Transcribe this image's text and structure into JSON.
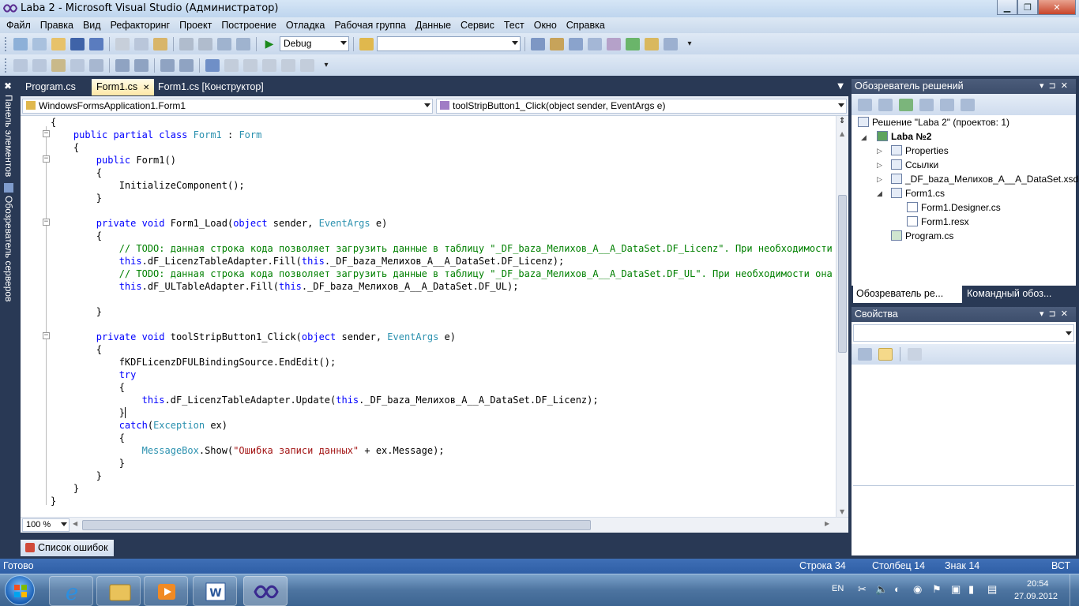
{
  "window": {
    "title": "Laba 2 - Microsoft Visual Studio (Администратор)"
  },
  "menu": [
    "Файл",
    "Правка",
    "Вид",
    "Рефакторинг",
    "Проект",
    "Построение",
    "Отладка",
    "Рабочая группа",
    "Данные",
    "Сервис",
    "Тест",
    "Окно",
    "Справка"
  ],
  "toolbar": {
    "config": "Debug",
    "find": ""
  },
  "side_panels": {
    "toolbox": "Панель элементов",
    "server_explorer": "Обозреватель серверов"
  },
  "tabs": [
    {
      "label": "Program.cs"
    },
    {
      "label": "Form1.cs",
      "active": true,
      "close": "✕"
    },
    {
      "label": "Form1.cs [Конструктор]"
    }
  ],
  "nav": {
    "class": "WindowsFormsApplication1.Form1",
    "member": "toolStripButton1_Click(object sender, EventArgs e)"
  },
  "code": [
    "{",
    "    public partial class Form1 : Form",
    "    {",
    "        public Form1()",
    "        {",
    "            InitializeComponent();",
    "        }",
    "",
    "        private void Form1_Load(object sender, EventArgs e)",
    "        {",
    "            // TODO: данная строка кода позволяет загрузить данные в таблицу \"_DF_baza_Мелихов_А__А_DataSet.DF_Licenz\". При необходимости она",
    "            this.dF_LicenzTableAdapter.Fill(this._DF_baza_Мелихов_А__А_DataSet.DF_Licenz);",
    "            // TODO: данная строка кода позволяет загрузить данные в таблицу \"_DF_baza_Мелихов_А__А_DataSet.DF_UL\". При необходимости она може",
    "            this.dF_ULTableAdapter.Fill(this._DF_baza_Мелихов_А__А_DataSet.DF_UL);",
    "",
    "        }",
    "",
    "        private void toolStripButton1_Click(object sender, EventArgs e)",
    "        {",
    "            fKDFLicenzDFULBindingSource.EndEdit();",
    "            try",
    "            {",
    "                this.dF_LicenzTableAdapter.Update(this._DF_baza_Мелихов_А__А_DataSet.DF_Licenz);",
    "            }",
    "            catch(Exception ex)",
    "            {",
    "                MessageBox.Show(\"Ошибка записи данных\" + ex.Message);",
    "            }",
    "        }",
    "    }",
    "}"
  ],
  "zoom": "100 %",
  "error_list": "Список ошибок",
  "solution_explorer": {
    "title": "Обозреватель решений",
    "solution": "Решение \"Laba 2\"  (проектов: 1)",
    "project": "Laba №2",
    "items": [
      "Properties",
      "Ссылки",
      "_DF_baza_Мелихов_А__А_DataSet.xsd",
      "Form1.cs",
      "Form1.Designer.cs",
      "Form1.resx",
      "Program.cs"
    ],
    "tab1": "Обозреватель ре...",
    "tab2": "Командный обоз..."
  },
  "properties": {
    "title": "Свойства"
  },
  "status": {
    "ready": "Готово",
    "line": "Строка 34",
    "col": "Столбец 14",
    "char": "Знак 14",
    "mode": "ВСТ"
  },
  "tray": {
    "lang": "EN",
    "time": "20:54",
    "date": "27.09.2012"
  },
  "colors": {
    "accent": "#293955",
    "keyword": "#0000ff",
    "type": "#2b91af",
    "comment": "#008000",
    "string": "#a31515"
  }
}
